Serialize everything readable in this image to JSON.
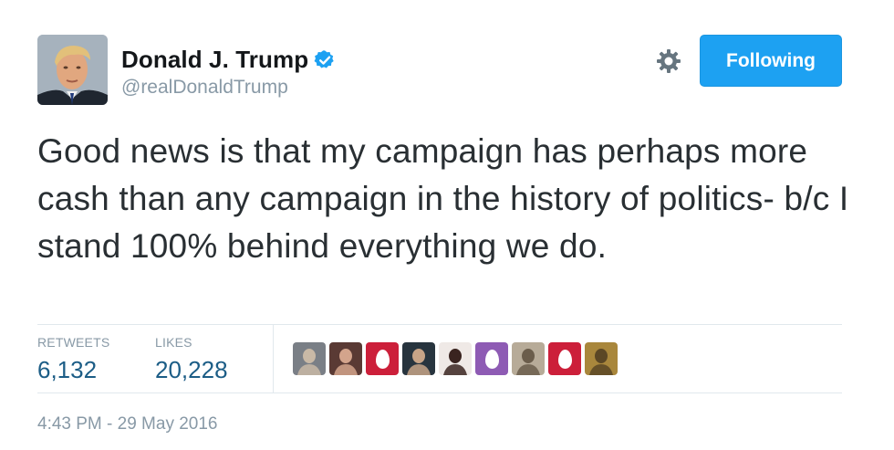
{
  "author": {
    "display_name": "Donald J. Trump",
    "handle": "@realDonaldTrump",
    "verified": true,
    "avatar_icon": "profile-photo"
  },
  "actions": {
    "settings_icon": "gear-icon",
    "follow_label": "Following"
  },
  "tweet": {
    "text": "Good news is that my campaign has perhaps more cash than any campaign in the history of politics- b/c I stand 100% behind everything we do."
  },
  "stats": {
    "retweets_label": "RETWEETS",
    "retweets_value": "6,132",
    "likes_label": "LIKES",
    "likes_value": "20,228"
  },
  "likers": [
    {
      "type": "photo",
      "bg": "#7a7f86",
      "fg": "#c9b9a6"
    },
    {
      "type": "photo",
      "bg": "#5a3a34",
      "fg": "#d3a48c"
    },
    {
      "type": "egg",
      "bg": "#cc1f3a"
    },
    {
      "type": "photo",
      "bg": "#27343e",
      "fg": "#c7a487"
    },
    {
      "type": "photo",
      "bg": "#efe9e6",
      "fg": "#3a2420"
    },
    {
      "type": "egg",
      "bg": "#8e5bb4"
    },
    {
      "type": "photo",
      "bg": "#b7ab98",
      "fg": "#6b5d4b"
    },
    {
      "type": "egg",
      "bg": "#cc1f3a"
    },
    {
      "type": "photo",
      "bg": "#a9873c",
      "fg": "#5b4725"
    }
  ],
  "timestamp": "4:43 PM - 29 May 2016",
  "colors": {
    "accent": "#1da1f2",
    "verified_badge": "#1da1f2",
    "stat_value": "#1c5d86",
    "muted": "#8899a6"
  }
}
